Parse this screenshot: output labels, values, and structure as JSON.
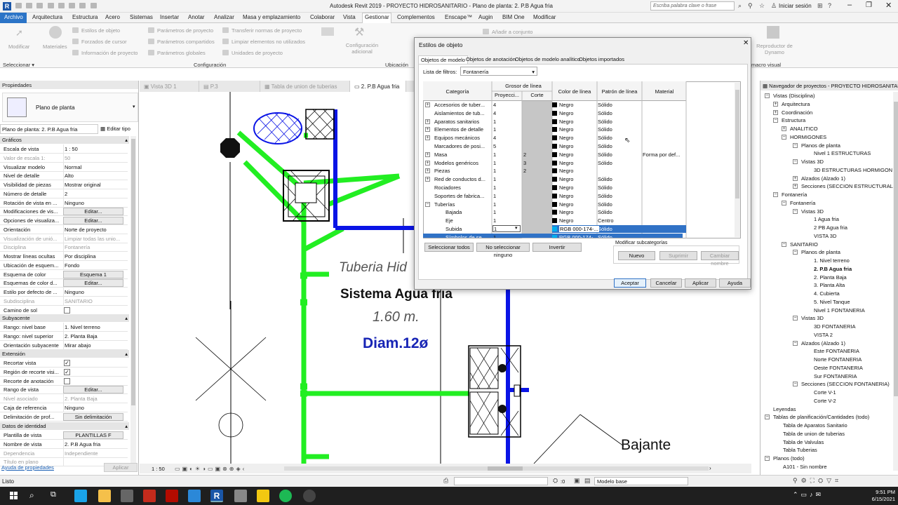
{
  "title_bar": {
    "app_title": "Autodesk Revit 2019 - PROYECTO HIDROSANITARIO - Plano de planta: 2. P.B Agua fria",
    "search_placeholder": "Escriba palabra clave o frase",
    "signin": "Iniciar sesión"
  },
  "ribbon_tabs": [
    {
      "label": "Archivo",
      "active_file": true
    },
    {
      "label": "Arquitectura"
    },
    {
      "label": "Estructura"
    },
    {
      "label": "Acero"
    },
    {
      "label": "Sistemas"
    },
    {
      "label": "Insertar"
    },
    {
      "label": "Anotar"
    },
    {
      "label": "Analizar"
    },
    {
      "label": "Masa y emplazamiento"
    },
    {
      "label": "Colaborar"
    },
    {
      "label": "Vista"
    },
    {
      "label": "Gestionar",
      "active": true
    },
    {
      "label": "Complementos"
    },
    {
      "label": "Enscape™"
    },
    {
      "label": "Augin"
    },
    {
      "label": "BIM One"
    },
    {
      "label": "Modificar"
    }
  ],
  "ribbon": {
    "modificar": "Modificar",
    "materiales": "Materiales",
    "estilos_objeto": "Estilos de objeto",
    "forzados_cursor": "Forzados de cursor",
    "info_proyecto": "Información de proyecto",
    "param_proyecto": "Parámetros de proyecto",
    "param_compartidos": "Parámetros compartidos",
    "param_globales": "Parámetros  globales",
    "transferir": "Transferir normas de proyecto",
    "limpiar": "Limpiar elementos no utilizados",
    "unidades": "Unidades de proyecto",
    "config_adicional": "Configuración adicional",
    "anadir_conjunto": "Añadir a conjunto",
    "reproductor": "Reproductor de Dynamo",
    "group_seleccionar": "Seleccionar",
    "group_configuracion": "Configuración",
    "group_ubicacion": "Ubicación",
    "group_macro_visual": "macro visual"
  },
  "properties": {
    "header": "Propiedades",
    "type_name": "Plano de planta",
    "instance_selector": "Plano de planta: 2. P.B Agua fria",
    "edit_type": "Editar tipo",
    "sections": {
      "graficos": "Gráficos",
      "subyacente": "Subyacente",
      "extension": "Extensión",
      "identidad": "Datos de identidad"
    },
    "rows": [
      {
        "k": "Escala de vista",
        "v": "1 : 50"
      },
      {
        "k": "Valor de escala   1:",
        "v": "50",
        "dis": true
      },
      {
        "k": "Visualizar modelo",
        "v": "Normal"
      },
      {
        "k": "Nivel de detalle",
        "v": "Alto"
      },
      {
        "k": "Visibilidad de piezas",
        "v": "Mostrar original"
      },
      {
        "k": "Número de detalle",
        "v": "2"
      },
      {
        "k": "Rotación de vista en ...",
        "v": "Ninguno"
      },
      {
        "k": "Modificaciones de vis...",
        "btn": "Editar..."
      },
      {
        "k": "Opciones de visualiza...",
        "btn": "Editar..."
      },
      {
        "k": "Orientación",
        "v": "Norte de proyecto"
      },
      {
        "k": "Visualización de unió...",
        "v": "Limpiar todas las unio...",
        "dis": true
      },
      {
        "k": "Disciplina",
        "v": "Fontanería",
        "dis": true
      },
      {
        "k": "Mostrar líneas ocultas",
        "v": "Por disciplina"
      },
      {
        "k": "Ubicación de esquem...",
        "v": "Fondo"
      },
      {
        "k": "Esquema de color",
        "btn": "Esquema 1"
      },
      {
        "k": "Esquemas de color d...",
        "btn": "Editar..."
      },
      {
        "k": "Estilo por defecto de ...",
        "v": "Ninguno"
      },
      {
        "k": "Subdisciplina",
        "v": "SANITARIO",
        "dis": true
      },
      {
        "k": "Camino de sol",
        "chk": ""
      }
    ],
    "rows_sub": [
      {
        "k": "Rango: nivel base",
        "v": "1. Nivel terreno"
      },
      {
        "k": "Rango: nivel superior",
        "v": "2. Planta Baja"
      },
      {
        "k": "Orientación subyacente",
        "v": "Mirar abajo"
      }
    ],
    "rows_ext": [
      {
        "k": "Recortar vista",
        "chk": "✓"
      },
      {
        "k": "Región de recorte visi...",
        "chk": "✓"
      },
      {
        "k": "Recorte de anotación",
        "chk": ""
      },
      {
        "k": "Rango de vista",
        "btn": "Editar..."
      },
      {
        "k": "Nivel asociado",
        "v": "2. Planta Baja",
        "dis": true
      },
      {
        "k": "Caja de referencia",
        "v": "Ninguno"
      },
      {
        "k": "Delimitación de prof...",
        "btn": "Sin delimitación"
      }
    ],
    "rows_id": [
      {
        "k": "Plantilla de vista",
        "btn": "PLANTILLAS F"
      },
      {
        "k": "Nombre de vista",
        "v": "2. P.B Agua fria"
      },
      {
        "k": "Dependencia",
        "v": "Independiente",
        "dis": true
      },
      {
        "k": "Título en plano",
        "v": "",
        "dis": true
      }
    ],
    "help_link": "Ayuda de propiedades",
    "apply": "Aplicar"
  },
  "view_tabs": [
    {
      "label": "Vista 3D 1"
    },
    {
      "label": "P.3"
    },
    {
      "label": "Tabla de union de tuberias"
    },
    {
      "label": "2. P.B Agua fria",
      "active": true
    }
  ],
  "canvas_text": {
    "tuberia": "Tuberia Hid",
    "sistema": "Sistema Agua fria",
    "altura": "1.60  m.",
    "diam": "Diam.12ø",
    "bajante": "Bajante"
  },
  "view_bar": {
    "scale": "1 : 50"
  },
  "dialog": {
    "title": "Estilos de objeto",
    "tabs": [
      "Objetos de modelo",
      "Objetos de anotación",
      "Objetos de modelo analítico",
      "Objetos importados"
    ],
    "filter_label": "Lista de filtros:",
    "filter_value": "Fontanería",
    "headers": {
      "categoria": "Categoría",
      "grosor": "Grosor de línea",
      "proyeccion": "Proyecci...",
      "corte": "Corte",
      "color": "Color de línea",
      "patron": "Patrón de línea",
      "material": "Material"
    },
    "rows": [
      {
        "cat": "Accesorios de tuber...",
        "p": "4",
        "c": "",
        "col": "Negro",
        "pat": "Sólido",
        "mat": "",
        "exp": "+"
      },
      {
        "cat": "Aislamientos de tub...",
        "p": "4",
        "c": "",
        "col": "Negro",
        "pat": "Sólido",
        "mat": ""
      },
      {
        "cat": "Aparatos sanitarios",
        "p": "1",
        "c": "",
        "col": "Negro",
        "pat": "Sólido",
        "mat": "",
        "exp": "+"
      },
      {
        "cat": "Elementos de detalle",
        "p": "1",
        "c": "",
        "col": "Negro",
        "pat": "Sólido",
        "mat": "",
        "exp": "+"
      },
      {
        "cat": "Equipos mecánicos",
        "p": "4",
        "c": "",
        "col": "Negro",
        "pat": "Sólido",
        "mat": "",
        "exp": "+"
      },
      {
        "cat": "Marcadores de posi...",
        "p": "5",
        "c": "",
        "col": "Negro",
        "pat": "Sólido",
        "mat": ""
      },
      {
        "cat": "Masa",
        "p": "1",
        "c": "2",
        "col": "Negro",
        "pat": "Sólido",
        "mat": "Forma por def...",
        "exp": "+"
      },
      {
        "cat": "Modelos genéricos",
        "p": "1",
        "c": "3",
        "col": "Negro",
        "pat": "Sólido",
        "mat": "",
        "exp": "+"
      },
      {
        "cat": "Piezas",
        "p": "1",
        "c": "2",
        "col": "Negro",
        "pat": "",
        "mat": "",
        "exp": "+"
      },
      {
        "cat": "Red de conductos d...",
        "p": "1",
        "c": "",
        "col": "Negro",
        "pat": "Sólido",
        "mat": "",
        "exp": "+"
      },
      {
        "cat": "Rociadores",
        "p": "1",
        "c": "",
        "col": "Negro",
        "pat": "Sólido",
        "mat": ""
      },
      {
        "cat": "Soportes de fabrica...",
        "p": "1",
        "c": "",
        "col": "Negro",
        "pat": "Sólido",
        "mat": ""
      },
      {
        "cat": "Tuberías",
        "p": "1",
        "c": "",
        "col": "Negro",
        "pat": "Sólido",
        "mat": "",
        "exp": "−"
      },
      {
        "cat": "Bajada",
        "p": "1",
        "c": "",
        "col": "Negro",
        "pat": "Sólido",
        "mat": "",
        "sub": true
      },
      {
        "cat": "Eje",
        "p": "1",
        "c": "",
        "col": "Negro",
        "pat": "Centro",
        "mat": "",
        "sub": true
      },
      {
        "cat": "Subida",
        "p": "1",
        "c": "",
        "col": "RGB 000-174-...",
        "pat": "Sólido",
        "mat": "",
        "sub": true,
        "sel": true,
        "swatch": "#00aeef"
      },
      {
        "cat": "Símbolos de se...",
        "p": "1",
        "c": "",
        "col": "RGB 000-174-...",
        "pat": "Sólido",
        "mat": "",
        "sub": true,
        "sel2": true,
        "swatch": "#00aeef"
      }
    ],
    "btn_select_all": "Seleccionar todos",
    "btn_select_none": "No seleccionar ninguno",
    "btn_invert": "Invertir",
    "sub_label": "Modificar subcategorías",
    "btn_new": "Nuevo",
    "btn_delete": "Suprimir",
    "btn_rename": "Cambiar nombre",
    "btn_accept": "Aceptar",
    "btn_cancel": "Cancelar",
    "btn_apply": "Aplicar",
    "btn_help": "Ayuda"
  },
  "navigator": {
    "title": "Navegador de proyectos - PROYECTO HIDROSANITARIO",
    "items": [
      {
        "t": "Vistas (Disciplina)",
        "lvl": 0,
        "exp": "−"
      },
      {
        "t": "Arquitectura",
        "lvl": 1,
        "exp": "+"
      },
      {
        "t": "Coordinación",
        "lvl": 1,
        "exp": "+"
      },
      {
        "t": "Estructura",
        "lvl": 1,
        "exp": "−"
      },
      {
        "t": "ANALITICO",
        "lvl": 2,
        "exp": "+"
      },
      {
        "t": "HORMIGONES",
        "lvl": 2,
        "exp": "−"
      },
      {
        "t": "Planos de planta",
        "lvl": 3,
        "exp": "−"
      },
      {
        "t": "Nivel 1 ESTRUCTURAS",
        "lvl": 4
      },
      {
        "t": "Vistas 3D",
        "lvl": 3,
        "exp": "−"
      },
      {
        "t": "3D ESTRUCTURAS HORMIGON",
        "lvl": 4
      },
      {
        "t": "Alzados (Alzado 1)",
        "lvl": 3,
        "exp": "+"
      },
      {
        "t": "Secciones (SECCION ESTRUCTURAL)",
        "lvl": 3,
        "exp": "+"
      },
      {
        "t": "Fontanería",
        "lvl": 1,
        "exp": "−"
      },
      {
        "t": "Fontanería",
        "lvl": 2,
        "exp": "−"
      },
      {
        "t": "Vistas 3D",
        "lvl": 3,
        "exp": "−"
      },
      {
        "t": "1 Agua fria",
        "lvl": 4
      },
      {
        "t": "2 PB Agua fria",
        "lvl": 4
      },
      {
        "t": "VISTA 3D",
        "lvl": 4
      },
      {
        "t": "SANITARIO",
        "lvl": 2,
        "exp": "−"
      },
      {
        "t": "Planos de planta",
        "lvl": 3,
        "exp": "−"
      },
      {
        "t": "1. Nivel terreno",
        "lvl": 4
      },
      {
        "t": "2. P.B Agua fria",
        "lvl": 4,
        "bold": true
      },
      {
        "t": "2. Planta Baja",
        "lvl": 4
      },
      {
        "t": "3. Planta Alta",
        "lvl": 4
      },
      {
        "t": "4. Cubierta",
        "lvl": 4
      },
      {
        "t": "5. Nivel Tanque",
        "lvl": 4
      },
      {
        "t": "Nivel 1 FONTANERIA",
        "lvl": 4
      },
      {
        "t": "Vistas 3D",
        "lvl": 3,
        "exp": "−"
      },
      {
        "t": "3D FONTANERIA",
        "lvl": 4
      },
      {
        "t": "VISTA 2",
        "lvl": 4
      },
      {
        "t": "Alzados (Alzado 1)",
        "lvl": 3,
        "exp": "−"
      },
      {
        "t": "Este FONTANERIA",
        "lvl": 4
      },
      {
        "t": "Norte FONTANERIA",
        "lvl": 4
      },
      {
        "t": "Oeste FONTANERIA",
        "lvl": 4
      },
      {
        "t": "Sur FONTANERIA",
        "lvl": 4
      },
      {
        "t": "Secciones (SECCION FONTANERIA)",
        "lvl": 3,
        "exp": "−"
      },
      {
        "t": "Corte V-1",
        "lvl": 4
      },
      {
        "t": "Corte V-2",
        "lvl": 4
      },
      {
        "t": "Leyendas",
        "lvl": 0,
        "exp": ""
      },
      {
        "t": "Tablas de planificación/Cantidades (todo)",
        "lvl": 0,
        "exp": "−"
      },
      {
        "t": "Tabla de Aparatos Sanitario",
        "lvl": 1
      },
      {
        "t": "Tabla de union de tuberias",
        "lvl": 1
      },
      {
        "t": "Tabla de Valvulas",
        "lvl": 1
      },
      {
        "t": "Tabla Tuberias",
        "lvl": 1
      },
      {
        "t": "Planos (todo)",
        "lvl": 0,
        "exp": "−"
      },
      {
        "t": "A101 - Sin nombre",
        "lvl": 1
      }
    ]
  },
  "status": {
    "text": "Listo",
    "zero": ":0",
    "model": "Modelo base"
  },
  "taskbar": {
    "time": "9:51 PM",
    "date": "6/15/2021"
  },
  "colors": {
    "pipe_green": "#22ee22",
    "pipe_blue": "#0a14e6",
    "accent": "#2b74c7",
    "selection": "#3072c6"
  }
}
